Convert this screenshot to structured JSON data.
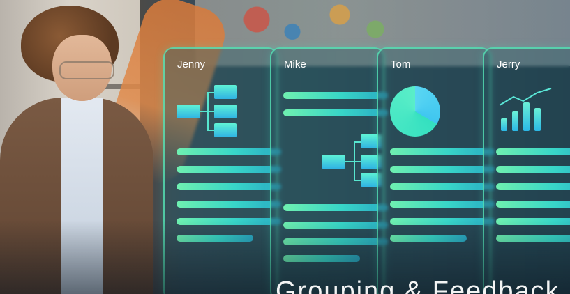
{
  "cards": [
    {
      "name": "Jenny"
    },
    {
      "name": "Mike"
    },
    {
      "name": "Tom"
    },
    {
      "name": "Jerry"
    }
  ],
  "headline": "Grouping & Feedback",
  "colors": {
    "card_border": "#5af0be",
    "accent_green": "#6ff0b0",
    "accent_cyan": "#2aa9c4"
  },
  "icons": [
    "flowchart-icon",
    "pie-chart-icon",
    "bar-chart-trend-icon"
  ]
}
